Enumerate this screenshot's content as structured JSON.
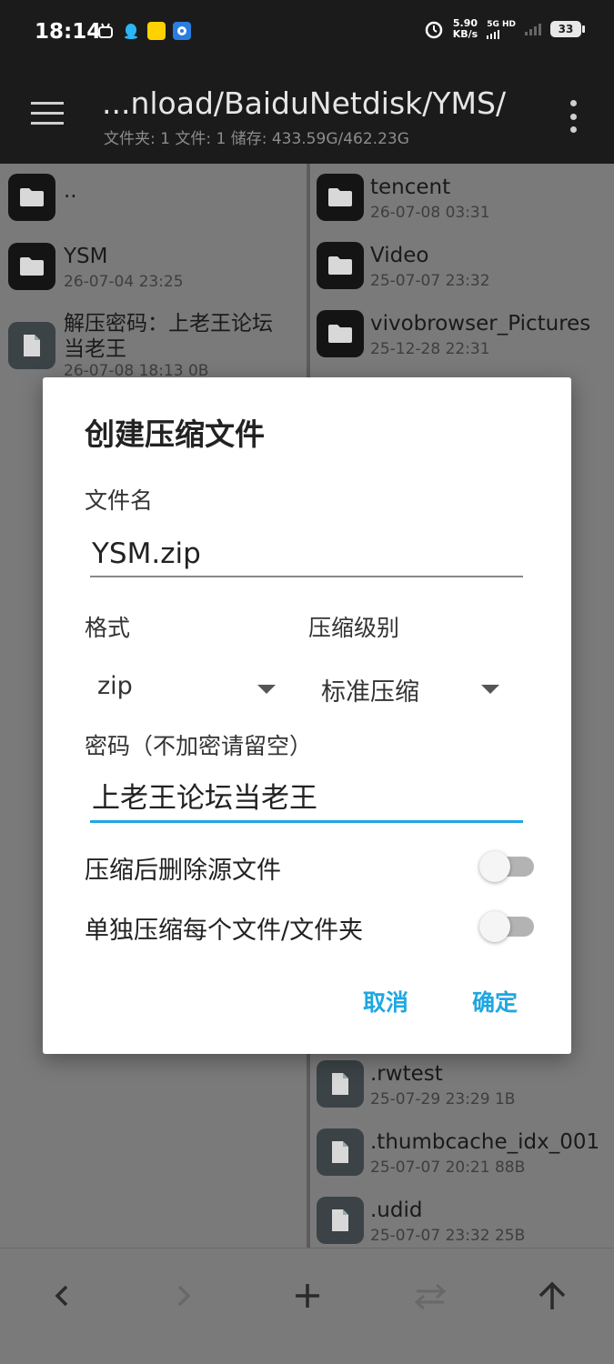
{
  "status_bar": {
    "time": "18:14",
    "speed_value": "5.90",
    "speed_unit": "KB/s",
    "network_top": "5G HD",
    "network_bottom": "",
    "battery": "33"
  },
  "app_bar": {
    "title": "...nload/BaiduNetdisk/YMS/",
    "subtitle": "文件夹: 1  文件: 1  储存: 433.59G/462.23G"
  },
  "left_pane": {
    "items": [
      {
        "name": "..",
        "meta": "",
        "type": "folder"
      },
      {
        "name": "YSM",
        "meta": "26-07-04 23:25",
        "type": "folder"
      },
      {
        "name": "解压密码：上老王论坛\n当老王",
        "meta": "26-07-08 18:13  0B",
        "type": "file"
      }
    ]
  },
  "right_pane": {
    "items": [
      {
        "name": "tencent",
        "meta": "26-07-08 03:31",
        "type": "folder"
      },
      {
        "name": "Video",
        "meta": "25-07-07 23:32",
        "type": "folder"
      },
      {
        "name": "vivobrowser_Pictures",
        "meta": "25-12-28 22:31",
        "type": "folder"
      },
      {
        "name": ".rwtest",
        "meta": "25-07-29 23:29  1B",
        "type": "file"
      },
      {
        "name": ".thumbcache_idx_001",
        "meta": "25-07-07 20:21  88B",
        "type": "file"
      },
      {
        "name": ".udid",
        "meta": "25-07-07 23:32  25B",
        "type": "file"
      }
    ]
  },
  "dialog": {
    "title": "创建压缩文件",
    "filename_label": "文件名",
    "filename_value": "YSM.zip",
    "format_label": "格式",
    "format_value": "zip",
    "level_label": "压缩级别",
    "level_value": "标准压缩",
    "password_label": "密码（不加密请留空）",
    "password_value": "上老王论坛当老王",
    "delete_source_label": "压缩后删除源文件",
    "delete_source_on": false,
    "separate_label": "单独压缩每个文件/文件夹",
    "separate_on": false,
    "cancel_label": "取消",
    "ok_label": "确定"
  },
  "colors": {
    "accent": "#1ea7e1",
    "appbar_bg": "#1b1b1b",
    "pane_bg_dimmed": "#7a7a7a"
  }
}
